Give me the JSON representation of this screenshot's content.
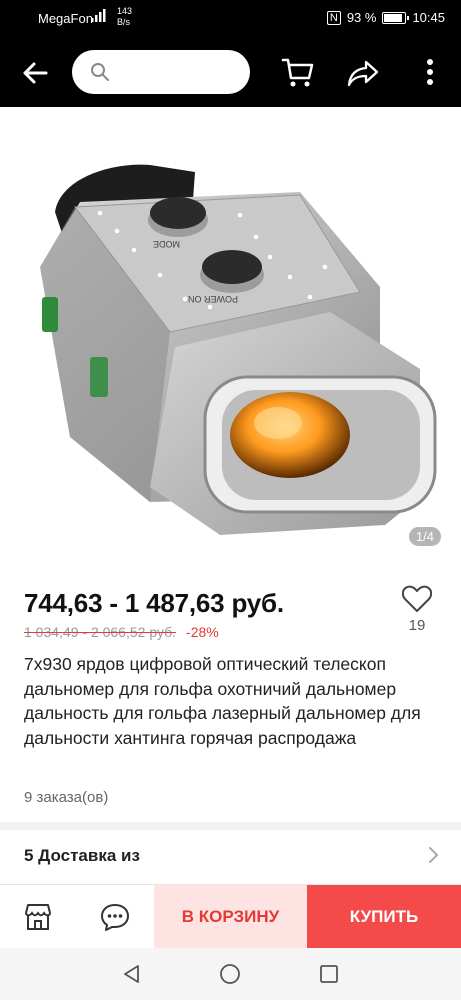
{
  "status_bar": {
    "carrier": "MegaFon",
    "net_speed_value": "143",
    "net_speed_unit": "B/s",
    "nfc": "N",
    "battery": "93 %",
    "battery_level": 0.93,
    "time": "10:45"
  },
  "toolbar": {
    "back_icon": "arrow-left",
    "search_placeholder": "",
    "cart_icon": "cart",
    "share_icon": "share-arrow",
    "more_icon": "vertical-ellipsis"
  },
  "gallery": {
    "counter": "1/4",
    "device_buttons": [
      "MODE",
      "POWER ON"
    ]
  },
  "product": {
    "price": "744,63 - 1 487,63 руб.",
    "old_price": "1 034,49 - 2 066,52 руб.",
    "discount": "-28%",
    "wishlist_count": "19",
    "title": "7x930 ярдов цифровой оптический телескоп дальномер для гольфа охотничий дальномер дальность для гольфа лазерный дальномер для дальности хантинга горячая распродажа",
    "orders": "9 заказа(ов)"
  },
  "delivery": {
    "label": "5 Доставка из"
  },
  "actions": {
    "add_to_cart": "В КОРЗИНУ",
    "buy": "КУПИТЬ"
  },
  "colors": {
    "accent_red": "#f44a4a",
    "cart_bg": "#fde3e1",
    "discount_red": "#e53935"
  }
}
